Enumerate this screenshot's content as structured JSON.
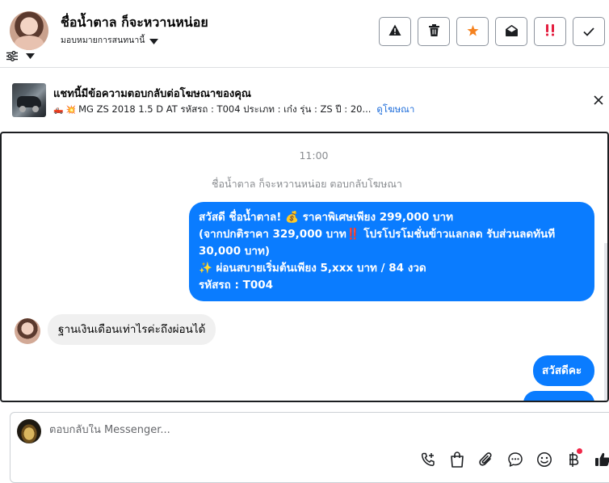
{
  "header": {
    "contact_name": "ชื่อน้ำตาล ก็จะหวานหน่อย",
    "assign_label": "มอบหมายการสนทนานี้",
    "actions": [
      {
        "name": "spam-button",
        "icon": "warning-icon"
      },
      {
        "name": "delete-button",
        "icon": "trash-icon"
      },
      {
        "name": "star-button",
        "icon": "star-icon",
        "color": "#f5821f"
      },
      {
        "name": "mark-unread-button",
        "icon": "envelope-open-icon"
      },
      {
        "name": "follow-up-button",
        "icon": "double-exclamation-icon",
        "color": "#e41e3f"
      },
      {
        "name": "mark-done-button",
        "icon": "check-icon"
      }
    ]
  },
  "banner": {
    "title": "แชทนี้มีข้อความตอบกลับต่อโฆษณาของคุณ",
    "emojis": "🛻 💥",
    "subtitle": "MG ZS 2018 1.5 D AT รหัสรถ : T004 ประเภท : เก๋ง รุ่น : ZS ปี : 20...",
    "link": "ดูโฆษณา"
  },
  "chat": {
    "timestamp": "11:00",
    "reply_note": "ชื่อน้ำตาล ก็จะหวานหน่อย ตอบกลับโฆษณา",
    "outgoing_1_lines": [
      "สวัสดี ชื่อน้ำตาล! 💰 ราคาพิเศษเพียง 299,000 บาท",
      "(จากปกติราคา 329,000 บาท‼️ โปรโปรโมชั่นข้าวแลกลด รับส่วนลดทันที",
      "30,000 บาท)",
      "✨ ผ่อนสบายเริ่มต้นเพียง 5,xxx บาท / 84 งวด",
      "รหัสรถ : T004"
    ],
    "incoming_1": "ฐานเงินเดือนเท่าไรค่ะถึงผ่อนได้",
    "outgoing_2": "สวัสดีคะ"
  },
  "composer": {
    "placeholder": "ตอบกลับใน Messenger...",
    "tools": [
      "call-add-icon",
      "shopping-bag-icon",
      "paperclip-icon",
      "chat-bubble-icon",
      "smiley-icon",
      "baht-icon",
      "thumbs-up-icon"
    ],
    "notification_dot_color": "#f02849"
  },
  "colors": {
    "accent": "#0a7cff",
    "link": "#216fdb"
  }
}
